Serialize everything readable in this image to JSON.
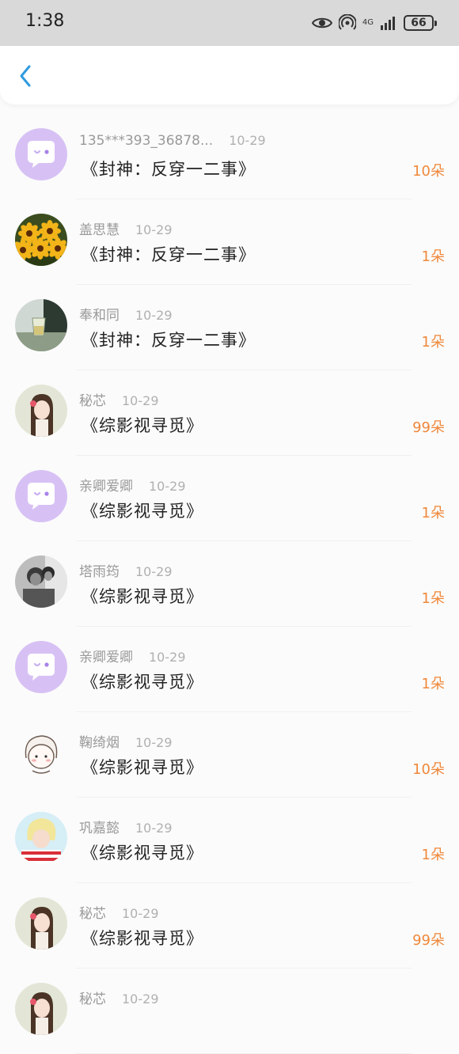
{
  "status": {
    "time": "1:38",
    "network": "4G",
    "battery": "66"
  },
  "header": {
    "back_icon": "chevron-left-icon"
  },
  "colors": {
    "accent": "#2f9ae0",
    "amount": "#f0883a"
  },
  "gifts": [
    {
      "name": "135***393_36878...",
      "date": "10-29",
      "book": "《封神：反穿一二事》",
      "amount": "10朵",
      "avatar": "chat-bubble"
    },
    {
      "name": "盖思慧",
      "date": "10-29",
      "book": "《封神：反穿一二事》",
      "amount": "1朵",
      "avatar": "flowers"
    },
    {
      "name": "奉和同",
      "date": "10-29",
      "book": "《封神：反穿一二事》",
      "amount": "1朵",
      "avatar": "glass"
    },
    {
      "name": "秘芯",
      "date": "10-29",
      "book": "《综影视寻觅》",
      "amount": "99朵",
      "avatar": "girl"
    },
    {
      "name": "亲卿爱卿",
      "date": "10-29",
      "book": "《综影视寻觅》",
      "amount": "1朵",
      "avatar": "chat-bubble"
    },
    {
      "name": "塔雨筠",
      "date": "10-29",
      "book": "《综影视寻觅》",
      "amount": "1朵",
      "avatar": "couple"
    },
    {
      "name": "亲卿爱卿",
      "date": "10-29",
      "book": "《综影视寻觅》",
      "amount": "1朵",
      "avatar": "chat-bubble"
    },
    {
      "name": "鞠绮烟",
      "date": "10-29",
      "book": "《综影视寻觅》",
      "amount": "10朵",
      "avatar": "cartoon"
    },
    {
      "name": "巩嘉懿",
      "date": "10-29",
      "book": "《综影视寻觅》",
      "amount": "1朵",
      "avatar": "blond"
    },
    {
      "name": "秘芯",
      "date": "10-29",
      "book": "《综影视寻觅》",
      "amount": "99朵",
      "avatar": "girl"
    },
    {
      "name": "秘芯",
      "date": "10-29",
      "book": "",
      "amount": "",
      "avatar": "girl"
    }
  ]
}
